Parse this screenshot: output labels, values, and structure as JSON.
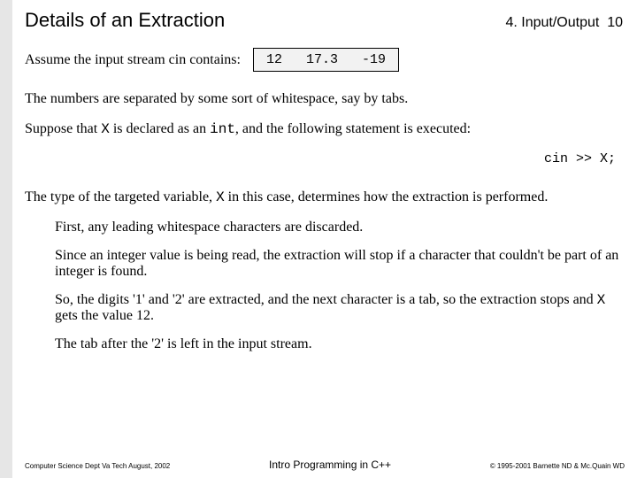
{
  "header": {
    "title": "Details of an Extraction",
    "section": "4. Input/Output",
    "page": "10"
  },
  "row1": {
    "lead": "Assume the input stream cin contains:",
    "stream": "12   17.3   -19"
  },
  "para1": "The numbers are separated by some sort of whitespace, say by tabs.",
  "para2a": "Suppose that ",
  "para2b": " is declared as an ",
  "para2c": ", and the following statement is executed:",
  "code": "cin >> X;",
  "para3a": "The type of the targeted variable, ",
  "para3b": " in this case, determines how the extraction is performed.",
  "indent": {
    "p1": "First, any leading whitespace characters are discarded.",
    "p2": "Since an integer value is being read, the extraction will stop if a character that couldn't be part of an integer is found.",
    "p3a": "So, the digits '1' and '2' are extracted, and the next character is a tab, so the extraction stops and ",
    "p3b": " gets the value 12.",
    "p4": "The tab after the '2' is left in the input stream."
  },
  "tokens": {
    "X": "X",
    "int": "int"
  },
  "footer": {
    "left": "Computer Science Dept Va Tech  August, 2002",
    "center": "Intro Programming in C++",
    "right": "© 1995-2001 Barnette ND & Mc.Quain WD"
  }
}
